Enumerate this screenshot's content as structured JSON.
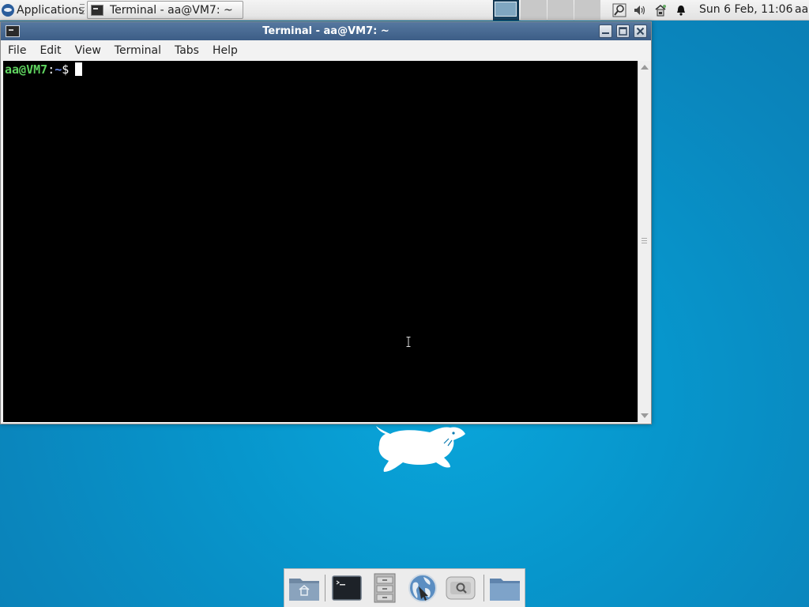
{
  "panel": {
    "applications_label": "Applications",
    "task_label": "Terminal - aa@VM7: ~",
    "clock": "Sun  6 Feb, 11:06",
    "user": "aa",
    "tray_icons": [
      "search-icon",
      "volume-icon",
      "network-icon",
      "notification-bell-icon"
    ]
  },
  "window": {
    "title": "Terminal - aa@VM7: ~",
    "buttons": [
      "minimize",
      "maximize",
      "close"
    ],
    "menu": [
      "File",
      "Edit",
      "View",
      "Terminal",
      "Tabs",
      "Help"
    ],
    "prompt": {
      "user_host": "aa@VM7",
      "colon": ":",
      "path": "~",
      "symbol": "$"
    }
  },
  "dock": {
    "items": [
      "home-folder-icon",
      "terminal-icon",
      "file-manager-icon",
      "web-browser-icon",
      "app-finder-icon",
      "folder-icon"
    ]
  },
  "colors": {
    "desktop": "#0796cc",
    "titlebar": "#4a6b93",
    "prompt_user": "#5fd35f",
    "prompt_path": "#6f8fef"
  }
}
